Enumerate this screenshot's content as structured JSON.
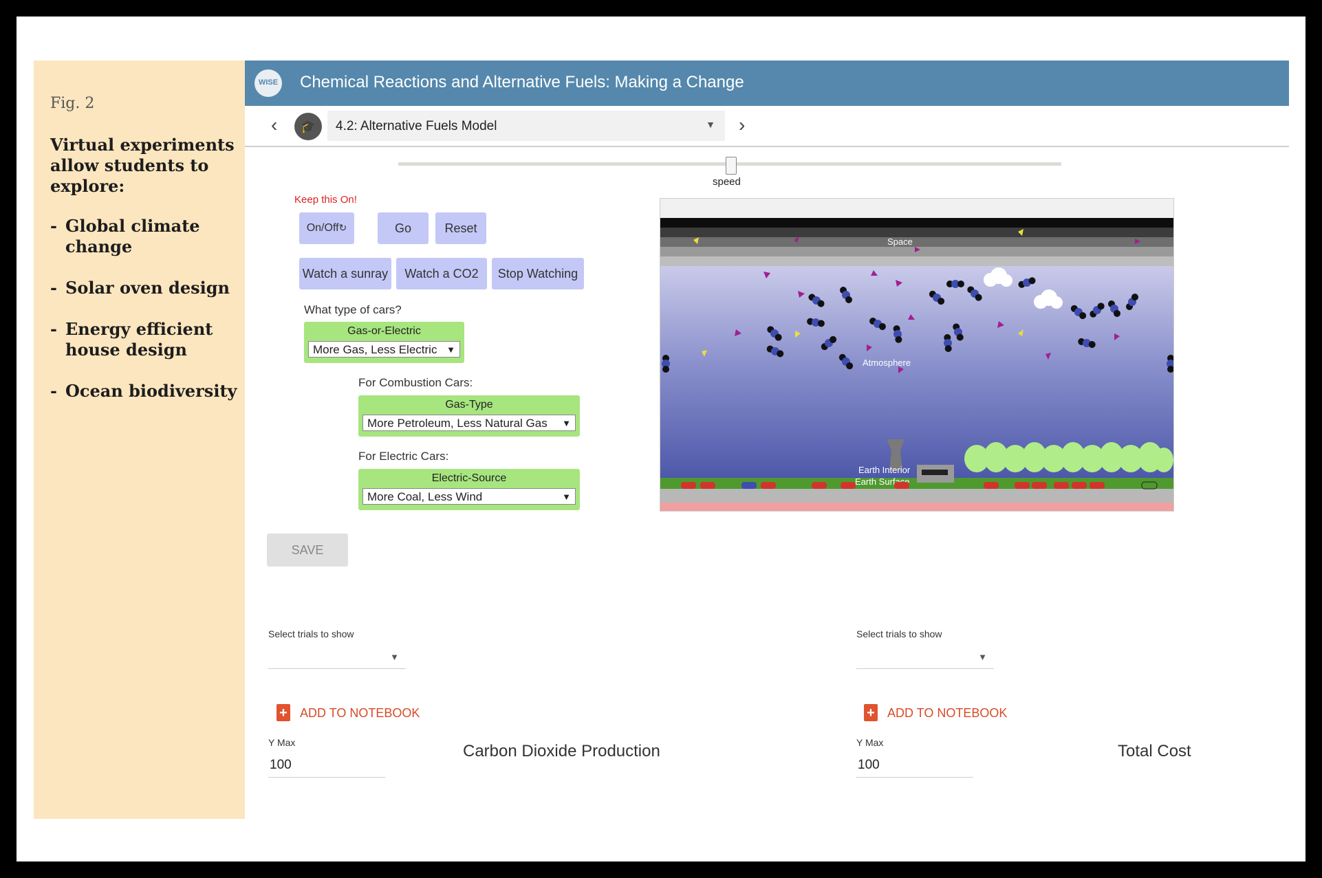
{
  "sidebar": {
    "fig": "Fig. 2",
    "intro": "Virtual experiments allow students to explore:",
    "items": [
      {
        "dash": "-",
        "text": "Global climate change"
      },
      {
        "dash": "-",
        "text": "Solar oven design"
      },
      {
        "dash": "-",
        "text": "Energy efficient house design"
      },
      {
        "dash": "-",
        "text": "Ocean biodiversity"
      }
    ]
  },
  "header": {
    "logo_text": "WISE",
    "title": "Chemical Reactions and Alternative Fuels: Making a Change"
  },
  "nav": {
    "step": "4.2: Alternative Fuels Model"
  },
  "model": {
    "speed_label": "speed",
    "keep_on": "Keep this On!",
    "onoff": "On/Off",
    "go": "Go",
    "reset": "Reset",
    "watch_sunray": "Watch a sunray",
    "watch_co2": "Watch a CO2",
    "stop_watching": "Stop Watching",
    "cars_question": "What type of cars?",
    "gas_or_electric": {
      "label": "Gas-or-Electric",
      "value": "More Gas, Less Electric"
    },
    "combustion_label": "For Combustion Cars:",
    "gas_type": {
      "label": "Gas-Type",
      "value": "More Petroleum, Less Natural Gas"
    },
    "electric_label": "For Electric Cars:",
    "electric_source": {
      "label": "Electric-Source",
      "value": "More Coal, Less Wind"
    },
    "sim_labels": {
      "space": "Space",
      "atmosphere": "Atmosphere",
      "earth_interior": "Earth Interior",
      "earth_surface": "Earth Surface"
    },
    "save": "SAVE"
  },
  "graphs": [
    {
      "select_label": "Select trials to show",
      "notebook": "ADD TO NOTEBOOK",
      "ymax_label": "Y Max",
      "ymax_value": "100",
      "title": "Carbon Dioxide Production"
    },
    {
      "select_label": "Select trials to show",
      "notebook": "ADD TO NOTEBOOK",
      "ymax_label": "Y Max",
      "ymax_value": "100",
      "title": "Total Cost"
    }
  ],
  "colors": {
    "header": "#5588ac",
    "button": "#c3c8f7",
    "dropdown_box": "#a7e57f",
    "notebook": "#d84b28",
    "sidebar": "#fce6bf"
  }
}
